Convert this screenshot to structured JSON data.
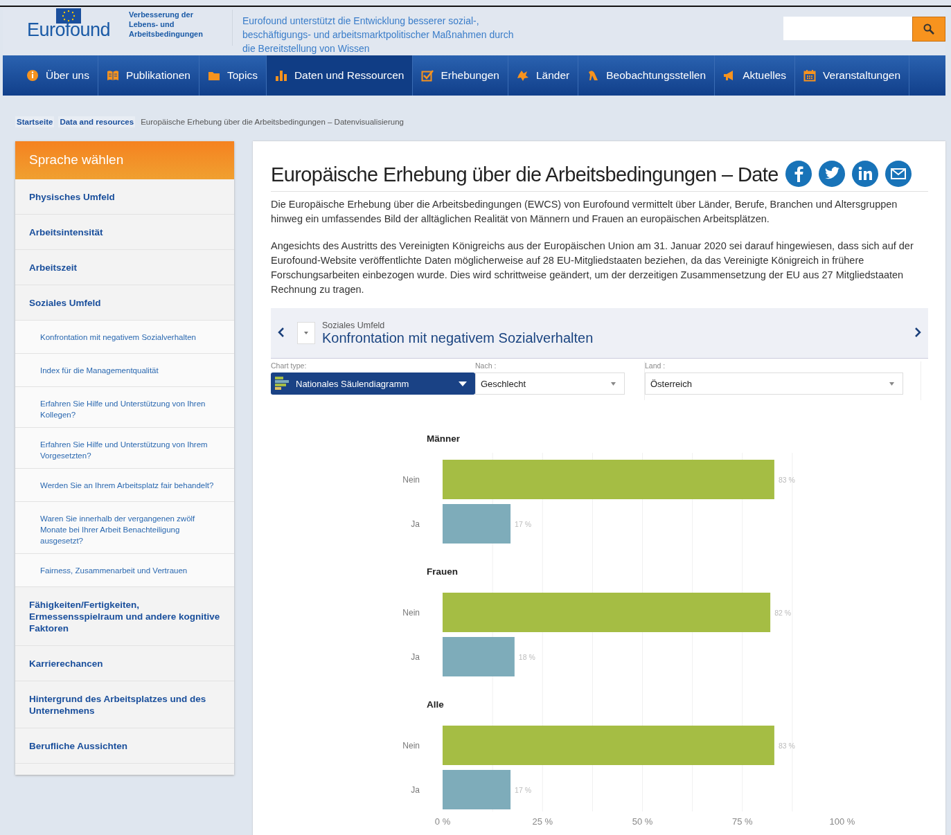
{
  "header": {
    "logo": "Eurofound",
    "tagline": "Verbesserung der Lebens- und Arbeitsbedingungen",
    "mission": "Eurofound unterstützt die Entwicklung besserer sozial-, beschäftigungs- und arbeitsmarktpolitischer Maßnahmen durch die Bereitstellung von Wissen"
  },
  "nav": [
    {
      "label": "Über uns",
      "selected": false
    },
    {
      "label": "Publikationen",
      "selected": false
    },
    {
      "label": "Topics",
      "selected": false
    },
    {
      "label": "Daten und Ressourcen",
      "selected": true
    },
    {
      "label": "Erhebungen",
      "selected": false
    },
    {
      "label": "Länder",
      "selected": false
    },
    {
      "label": "Beobachtungsstellen",
      "selected": false
    },
    {
      "label": "Aktuelles",
      "selected": false
    },
    {
      "label": "Veranstaltungen",
      "selected": false
    }
  ],
  "breadcrumb": [
    "Startseite",
    "Data and resources",
    "Europäische Erhebung über die Arbeitsbedingungen – Datenvisualisierung"
  ],
  "sidebar": {
    "title": "Sprache wählen",
    "items": [
      {
        "label": "Physisches Umfeld"
      },
      {
        "label": "Arbeitsintensität"
      },
      {
        "label": "Arbeitszeit"
      },
      {
        "label": "Soziales Umfeld",
        "children": [
          {
            "label": "Konfrontation mit negativem Sozialverhalten"
          },
          {
            "label": "Index für die Managementqualität"
          },
          {
            "label": "Erfahren Sie Hilfe und Unterstützung von Ihren Kollegen?"
          },
          {
            "label": "Erfahren Sie Hilfe und Unterstützung von Ihrem Vorgesetzten?"
          },
          {
            "label": "Werden Sie an Ihrem Arbeitsplatz fair behandelt?"
          },
          {
            "label": "Waren Sie innerhalb der vergangenen zwölf Monate bei Ihrer Arbeit Benachteiligung ausgesetzt?"
          },
          {
            "label": "Fairness, Zusammenarbeit und Vertrauen"
          }
        ]
      },
      {
        "label": "Fähigkeiten/Fertigkeiten, Ermessensspielraum und andere kognitive Faktoren"
      },
      {
        "label": "Karrierechancen"
      },
      {
        "label": "Hintergrund des Arbeitsplatzes und des Unternehmens"
      },
      {
        "label": "Berufliche Aussichten"
      }
    ]
  },
  "content": {
    "title": "Europäische Erhebung über die Arbeitsbedingungen – Date",
    "paragraphs": [
      "Die Europäische Erhebung über die Arbeitsbedingungen (EWCS) von Eurofound vermittelt über Länder, Berufe, Branchen und Altersgruppen hinweg ein umfassendes Bild der alltäglichen Realität von Männern und Frauen an europäischen Arbeitsplätzen.",
      "Angesichts des Austritts des Vereinigten Königreichs aus der Europäischen Union am 31. Januar 2020 sei darauf hingewiesen, dass sich auf der Eurofound-Website veröffentlichte Daten möglicherweise auf 28 EU-Mitgliedstaaten beziehen, da das Vereinigte Königreich in frühere Forschungsarbeiten einbezogen wurde. Dies wird schrittweise geändert, um der derzeitigen Zusammensetzung der EU aus 27 Mitgliedstaaten Rechnung zu tragen."
    ],
    "indicator": {
      "category": "Soziales Umfeld",
      "title": "Konfrontation mit negativem Sozialverhalten"
    },
    "filters": [
      {
        "kind": "chart",
        "label": "Chart type:",
        "value": "Nationales Säulendiagramm"
      },
      {
        "kind": "plain",
        "label": "Nach :",
        "value": "Geschlecht"
      },
      {
        "kind": "plain",
        "label": "Land :",
        "value": "Österreich"
      }
    ],
    "chart_data": {
      "type": "bar",
      "orientation": "horizontal",
      "categories": [
        "Männer",
        "Frauen",
        "Alle"
      ],
      "grid": true,
      "series": [
        {
          "name": "Nein",
          "color": "#a5bd44",
          "values": [
            83,
            82,
            83
          ],
          "value_labels": [
            "83 %",
            "82 %",
            "83 %"
          ]
        },
        {
          "name": "Ja",
          "color": "#7eacba",
          "values": [
            17,
            18,
            17
          ],
          "value_labels": [
            "17 %",
            "18 %",
            "17 %"
          ]
        }
      ],
      "xlim": [
        0,
        100
      ],
      "xticks": [
        {
          "value": 0,
          "label": "0 %"
        },
        {
          "value": 25,
          "label": "25 %"
        },
        {
          "value": 50,
          "label": "50 %"
        },
        {
          "value": 75,
          "label": "75 %"
        },
        {
          "value": 100,
          "label": "100 %"
        }
      ]
    }
  }
}
